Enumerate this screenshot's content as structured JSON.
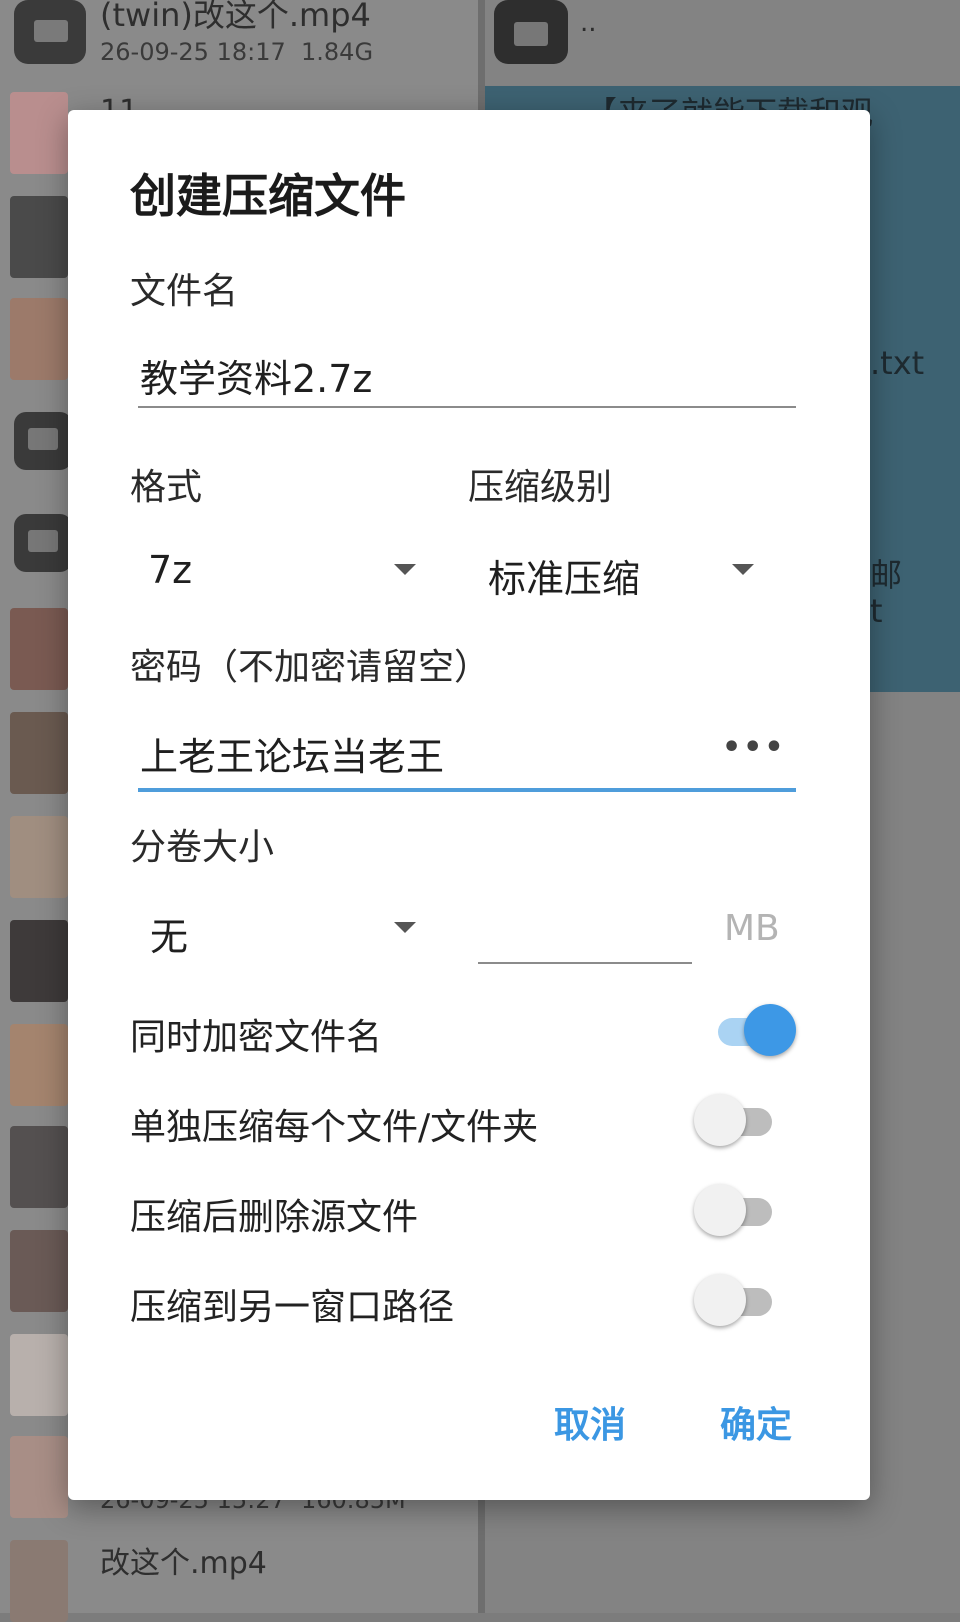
{
  "background": {
    "top_file": {
      "name": "(twin)改这个.mp4",
      "date": "26-09-25 18:17",
      "size": "1.84G"
    },
    "parent_dir": "..",
    "right_fragments": {
      "top": "【来了就能下载和观",
      "txt": ".txt",
      "mail": "邮",
      "t": "t"
    },
    "partial_item": "11",
    "bottom_file": {
      "date": "26-09-25 15:27",
      "size": "160.85M",
      "name": "改这个.mp4"
    }
  },
  "dialog": {
    "title": "创建压缩文件",
    "filename_label": "文件名",
    "filename_value": "教学资料2.7z",
    "format_label": "格式",
    "format_value": "7z",
    "level_label": "压缩级别",
    "level_value": "标准压缩",
    "password_label": "密码（不加密请留空）",
    "password_value": "上老王论坛当老王",
    "password_toggle": "•••",
    "split_label": "分卷大小",
    "split_value": "无",
    "split_size_value": "",
    "split_unit": "MB",
    "options": [
      {
        "label": "同时加密文件名",
        "on": true
      },
      {
        "label": "单独压缩每个文件/文件夹",
        "on": false
      },
      {
        "label": "压缩后删除源文件",
        "on": false
      },
      {
        "label": "压缩到另一窗口路径",
        "on": false
      }
    ],
    "cancel_label": "取消",
    "ok_label": "确定"
  },
  "colors": {
    "accent": "#3d98e6",
    "overlay": "#7c7c7c",
    "highlight": "#3d6272"
  },
  "icons": [
    "video-file-icon",
    "folder-icon",
    "dropdown-caret-icon",
    "password-visibility-icon"
  ]
}
